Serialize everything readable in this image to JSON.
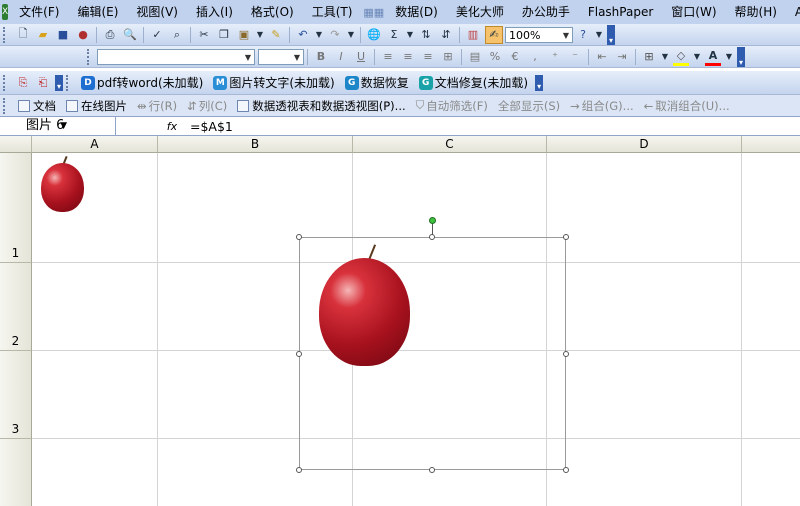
{
  "menubar": {
    "items": [
      "文件(F)",
      "编辑(E)",
      "视图(V)",
      "插入(I)",
      "格式(O)",
      "工具(T)",
      "数据(D)",
      "美化大师",
      "办公助手",
      "FlashPaper",
      "窗口(W)",
      "帮助(H)",
      "Adobe"
    ]
  },
  "toolbar": {
    "zoom": "100%",
    "font_name": "",
    "font_size": ""
  },
  "addins": {
    "items": [
      {
        "label": "pdf转word(未加载)",
        "badge": "D",
        "color": "#1f6fd0"
      },
      {
        "label": "图片转文字(未加载)",
        "badge": "M",
        "color": "#2a8ed6"
      },
      {
        "label": "数据恢复",
        "badge": "G",
        "color": "#1c86c8"
      },
      {
        "label": "文档修复(未加载)",
        "badge": "G",
        "color": "#19a3a8"
      }
    ]
  },
  "pivot_bar": {
    "doc": "文档",
    "online_pic": "在线图片",
    "row": "行(R)",
    "col": "列(C)",
    "pivot": "数据透视表和数据透视图(P)...",
    "autofilter": "自动筛选(F)",
    "show_all": "全部显示(S)",
    "group": "组合(G)...",
    "ungroup": "取消组合(U)..."
  },
  "formula_bar": {
    "name_box": "图片 6",
    "fx": "fx",
    "formula": "=$A$1"
  },
  "grid": {
    "columns": [
      "A",
      "B",
      "C",
      "D"
    ],
    "rows": [
      "1",
      "2",
      "3"
    ]
  },
  "colors": {
    "menubar": "#c1d2ee",
    "toolbar_accent": "#2f5cae",
    "handle_rotate": "#3ec13e"
  }
}
